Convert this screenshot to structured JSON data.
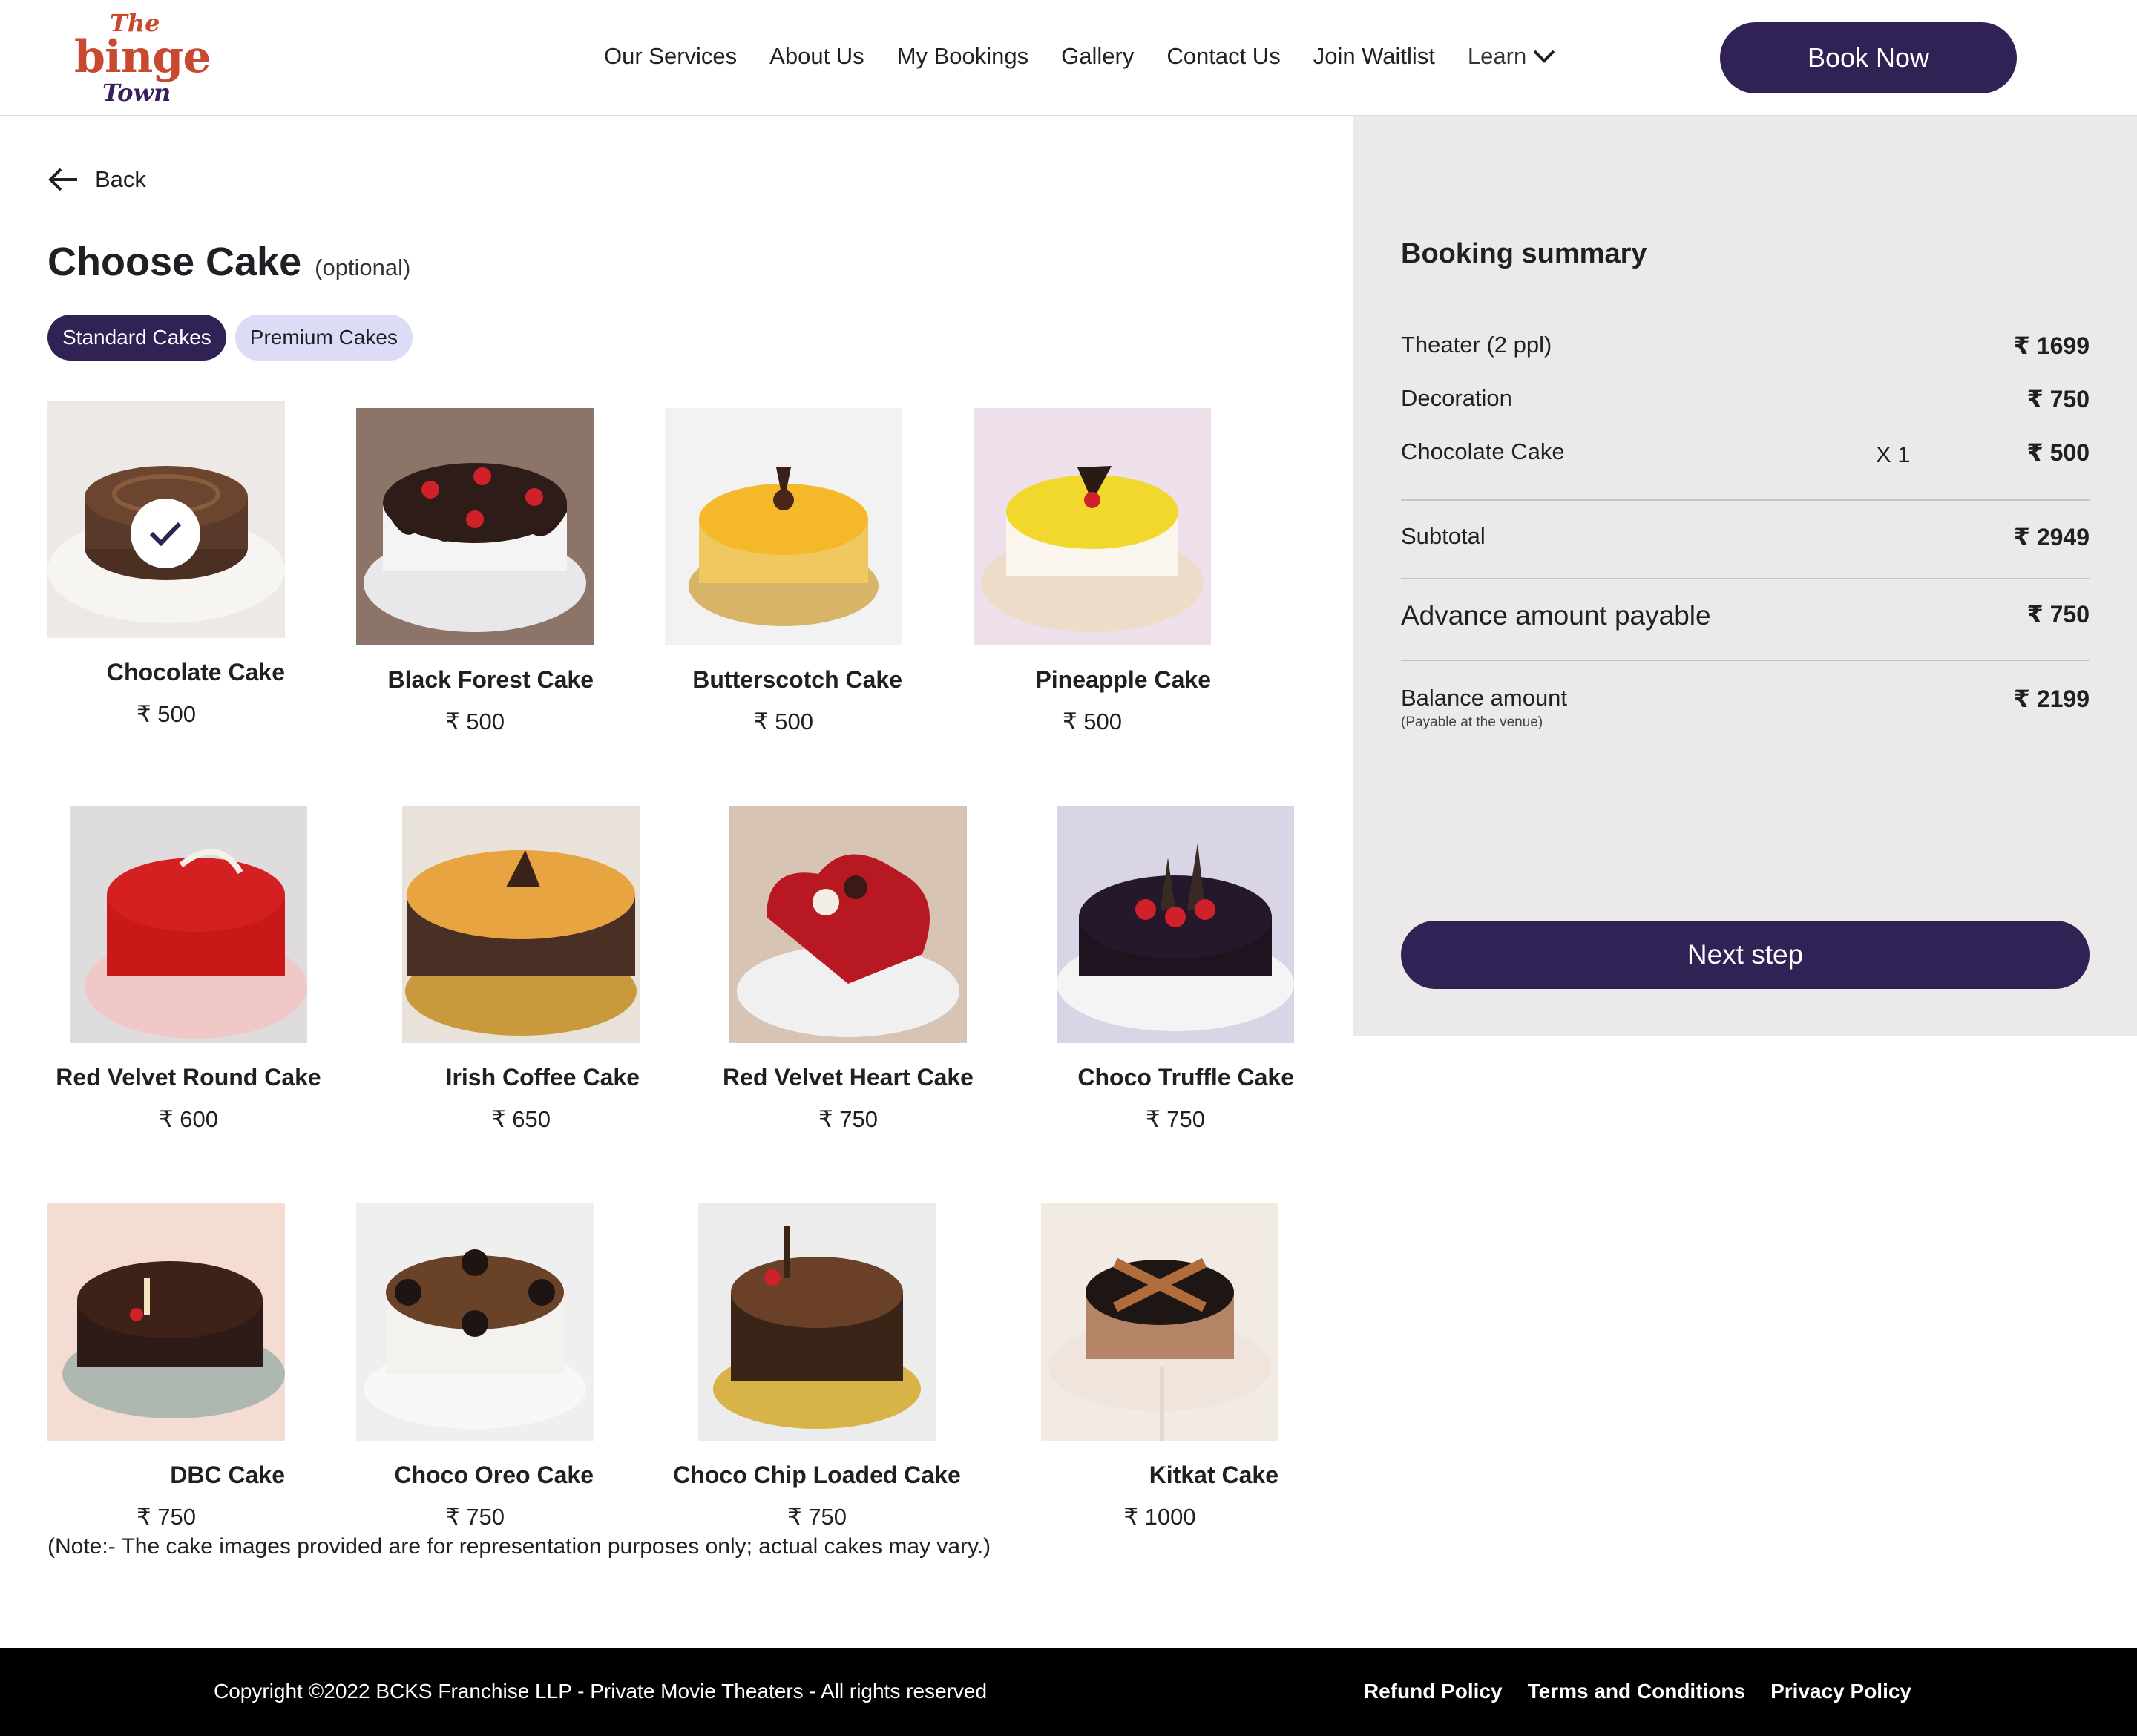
{
  "header": {
    "logo": {
      "line1": "The",
      "line2": "binge",
      "line3": "Town"
    },
    "nav": [
      "Our Services",
      "About Us",
      "My Bookings",
      "Gallery",
      "Contact Us",
      "Join Waitlist"
    ],
    "learn": "Learn",
    "book_now": "Book Now"
  },
  "main": {
    "back": "Back",
    "title": "Choose Cake",
    "optional": "(optional)",
    "tabs": [
      "Standard Cakes",
      "Premium Cakes"
    ],
    "active_tab": "Standard Cakes",
    "cakes": [
      {
        "name": "Chocolate Cake",
        "price": "₹ 500",
        "selected": true
      },
      {
        "name": "Black Forest Cake",
        "price": "₹ 500"
      },
      {
        "name": "Butterscotch Cake",
        "price": "₹ 500"
      },
      {
        "name": "Pineapple Cake",
        "price": "₹ 500"
      },
      {
        "name": "Red Velvet Round Cake",
        "price": "₹ 600"
      },
      {
        "name": "Irish Coffee Cake",
        "price": "₹ 650"
      },
      {
        "name": "Red Velvet Heart Cake",
        "price": "₹ 750"
      },
      {
        "name": "Choco Truffle Cake",
        "price": "₹ 750"
      },
      {
        "name": "DBC Cake",
        "price": "₹ 750"
      },
      {
        "name": "Choco Oreo Cake",
        "price": "₹ 750"
      },
      {
        "name": "Choco Chip Loaded Cake",
        "price": "₹ 750"
      },
      {
        "name": "Kitkat Cake",
        "price": "₹ 1000"
      }
    ],
    "note": "(Note:- The cake images provided are for representation purposes only; actual cakes may vary.)"
  },
  "summary": {
    "title": "Booking summary",
    "items": [
      {
        "label": "Theater (2 ppl)",
        "amount": "₹ 1699"
      },
      {
        "label": "Decoration",
        "amount": "₹ 750"
      },
      {
        "label": "Chocolate Cake",
        "qty": "X 1",
        "amount": "₹ 500"
      }
    ],
    "subtotal_label": "Subtotal",
    "subtotal": "₹ 2949",
    "advance_label": "Advance amount payable",
    "advance": "₹ 750",
    "balance_label": "Balance amount",
    "balance_note": "(Payable at the venue)",
    "balance": "₹ 2199",
    "next_step": "Next step"
  },
  "footer": {
    "copyright": "Copyright ©2022 BCKS Franchise LLP - Private Movie Theaters - All rights reserved",
    "links": [
      "Refund Policy",
      "Terms and Conditions",
      "Privacy Policy"
    ]
  },
  "colors": {
    "brand": "#302254",
    "tab_inactive": "#dcdcf7",
    "panel": "#eceae9",
    "logo_accent": "#c8492f"
  }
}
